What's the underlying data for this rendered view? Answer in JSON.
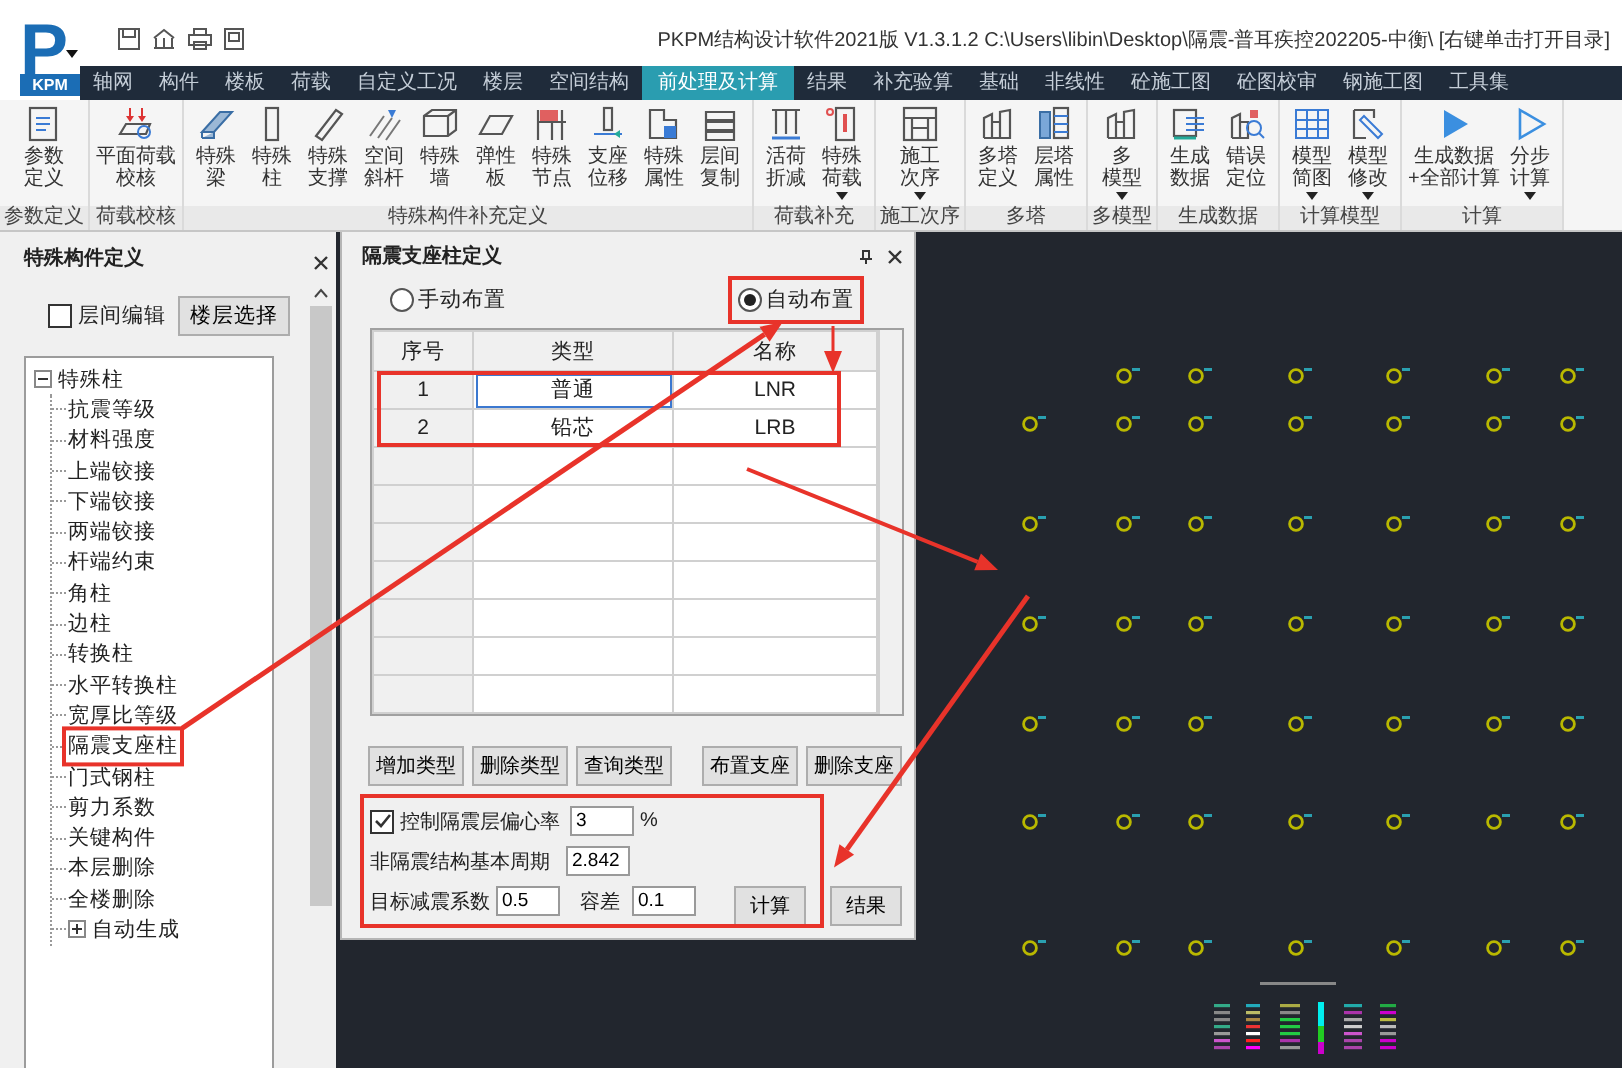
{
  "app": {
    "logo_letter": "P",
    "logo_text": "KPM",
    "title": "PKPM结构设计软件2021版 V1.3.1.2 C:\\Users\\libin\\Desktop\\隔震-普耳疾控202205-中衡\\ [右键单击打开目录]"
  },
  "menu_tabs": [
    {
      "label": "轴网",
      "selected": false
    },
    {
      "label": "构件",
      "selected": false
    },
    {
      "label": "楼板",
      "selected": false
    },
    {
      "label": "荷载",
      "selected": false
    },
    {
      "label": "自定义工况",
      "selected": false
    },
    {
      "label": "楼层",
      "selected": false
    },
    {
      "label": "空间结构",
      "selected": false
    },
    {
      "label": "前处理及计算",
      "selected": true
    },
    {
      "label": "结果",
      "selected": false
    },
    {
      "label": "补充验算",
      "selected": false
    },
    {
      "label": "基础",
      "selected": false
    },
    {
      "label": "非线性",
      "selected": false
    },
    {
      "label": "砼施工图",
      "selected": false
    },
    {
      "label": "砼图校审",
      "selected": false
    },
    {
      "label": "钢施工图",
      "selected": false
    },
    {
      "label": "工具集",
      "selected": false
    }
  ],
  "ribbon_groups": [
    {
      "label": "参数定义",
      "buttons": [
        {
          "lines": [
            "参数",
            "定义"
          ],
          "has_menu": false
        }
      ]
    },
    {
      "label": "荷载校核",
      "buttons": [
        {
          "lines": [
            "平面荷载",
            "校核"
          ],
          "has_menu": false
        }
      ]
    },
    {
      "label": "特殊构件补充定义",
      "buttons": [
        {
          "lines": [
            "特殊",
            "梁"
          ],
          "has_menu": false
        },
        {
          "lines": [
            "特殊",
            "柱"
          ],
          "has_menu": false
        },
        {
          "lines": [
            "特殊",
            "支撑"
          ],
          "has_menu": false
        },
        {
          "lines": [
            "空间",
            "斜杆"
          ],
          "has_menu": false
        },
        {
          "lines": [
            "特殊",
            "墙"
          ],
          "has_menu": false
        },
        {
          "lines": [
            "弹性",
            "板"
          ],
          "has_menu": false
        },
        {
          "lines": [
            "特殊",
            "节点"
          ],
          "has_menu": false
        },
        {
          "lines": [
            "支座",
            "位移"
          ],
          "has_menu": false
        },
        {
          "lines": [
            "特殊",
            "属性"
          ],
          "has_menu": false
        },
        {
          "lines": [
            "层间",
            "复制"
          ],
          "has_menu": false
        }
      ]
    },
    {
      "label": "荷载补充",
      "buttons": [
        {
          "lines": [
            "活荷",
            "折减"
          ],
          "has_menu": false
        },
        {
          "lines": [
            "特殊",
            "荷载"
          ],
          "has_menu": true
        }
      ]
    },
    {
      "label": "施工次序",
      "buttons": [
        {
          "lines": [
            "施工",
            "次序"
          ],
          "has_menu": true
        }
      ]
    },
    {
      "label": "多塔",
      "buttons": [
        {
          "lines": [
            "多塔",
            "定义"
          ],
          "has_menu": false
        },
        {
          "lines": [
            "层塔",
            "属性"
          ],
          "has_menu": false
        }
      ]
    },
    {
      "label": "多模型",
      "buttons": [
        {
          "lines": [
            "多",
            "模型"
          ],
          "has_menu": true
        }
      ]
    },
    {
      "label": "生成数据",
      "buttons": [
        {
          "lines": [
            "生成",
            "数据"
          ],
          "has_menu": false
        },
        {
          "lines": [
            "错误",
            "定位"
          ],
          "has_menu": false
        }
      ]
    },
    {
      "label": "计算模型",
      "buttons": [
        {
          "lines": [
            "模型",
            "简图"
          ],
          "has_menu": true
        },
        {
          "lines": [
            "模型",
            "修改"
          ],
          "has_menu": true
        }
      ]
    },
    {
      "label": "计算",
      "buttons": [
        {
          "lines": [
            "生成数据",
            "+全部计算"
          ],
          "has_menu": false
        },
        {
          "lines": [
            "分步",
            "计算"
          ],
          "has_menu": true
        }
      ]
    }
  ],
  "left_panel": {
    "title": "特殊构件定义",
    "floor_edit": {
      "label": "层间编辑",
      "checked": false
    },
    "floor_select_button": "楼层选择",
    "tree": [
      {
        "label": "特殊柱",
        "expanded": true,
        "children": [
          {
            "label": "抗震等级"
          },
          {
            "label": "材料强度"
          },
          {
            "label": "上端铰接"
          },
          {
            "label": "下端铰接"
          },
          {
            "label": "两端铰接"
          },
          {
            "label": "杆端约束"
          },
          {
            "label": "角柱"
          },
          {
            "label": "边柱"
          },
          {
            "label": "转换柱"
          },
          {
            "label": "水平转换柱"
          },
          {
            "label": "宽厚比等级"
          },
          {
            "label": "隔震支座柱"
          },
          {
            "label": "门式钢柱"
          },
          {
            "label": "剪力系数"
          },
          {
            "label": "关键构件"
          },
          {
            "label": "本层删除"
          },
          {
            "label": "全楼删除"
          },
          {
            "label": "自动生成",
            "expanded": false
          }
        ]
      }
    ]
  },
  "dialog": {
    "title": "隔震支座柱定义",
    "placement_options": [
      {
        "label": "手动布置",
        "selected": false
      },
      {
        "label": "自动布置",
        "selected": true
      }
    ],
    "table": {
      "columns": [
        "序号",
        "类型",
        "名称"
      ],
      "rows": [
        {
          "cells": [
            "1",
            "普通",
            "LNR"
          ],
          "selected": true
        },
        {
          "cells": [
            "2",
            "铅芯",
            "LRB"
          ],
          "selected": false
        }
      ]
    },
    "type_buttons": [
      "增加类型",
      "删除类型",
      "查询类型"
    ],
    "bearing_buttons": [
      "布置支座",
      "删除支座"
    ],
    "eccentricity": {
      "label": "控制隔震层偏心率",
      "checked": true,
      "value": "3",
      "unit": "%"
    },
    "period": {
      "label": "非隔震结构基本周期",
      "value": "2.842"
    },
    "reduction": {
      "label": "目标减震系数",
      "value": "0.5"
    },
    "tolerance": {
      "label": "容差",
      "value": "0.1"
    },
    "actions": [
      "计算",
      "结果"
    ]
  }
}
